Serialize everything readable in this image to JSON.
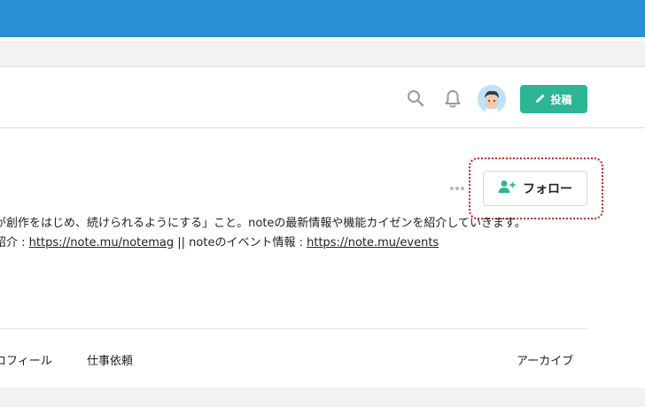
{
  "colors": {
    "browser_bar": "#2b8fd6",
    "accent": "#2cb696",
    "highlight": "#d42121"
  },
  "header": {
    "search_icon": "search-icon",
    "bell_icon": "bell-icon",
    "avatar": "avatar",
    "post_button_label": "投稿"
  },
  "profile": {
    "follow_button_label": "フォロー",
    "description_line1": "が創作をはじめ、続けられるようにする」こと。noteの最新情報や機能カイゼンを紹介していきます。",
    "description_line2_prefix": "紹介 : ",
    "link_notemag": "https://note.mu/notemag",
    "separator_text": " || noteのイベント情報 : ",
    "link_events": "https://note.mu/events"
  },
  "tabs": {
    "profile": "ロフィール",
    "work": "仕事依頼",
    "archive": "アーカイブ"
  }
}
